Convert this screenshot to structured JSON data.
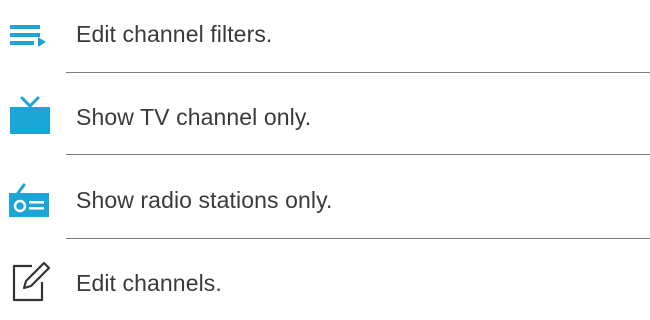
{
  "colors": {
    "accent": "#1aa6d6",
    "text": "#3a3a3a",
    "divider": "#7f7f7f",
    "outline_icon": "#333333"
  },
  "menu": {
    "items": [
      {
        "label": "Edit channel filters.",
        "icon": "filter-list-icon"
      },
      {
        "label": "Show TV channel only.",
        "icon": "tv-icon"
      },
      {
        "label": "Show radio stations only.",
        "icon": "radio-icon"
      },
      {
        "label": "Edit channels.",
        "icon": "edit-icon"
      }
    ]
  }
}
